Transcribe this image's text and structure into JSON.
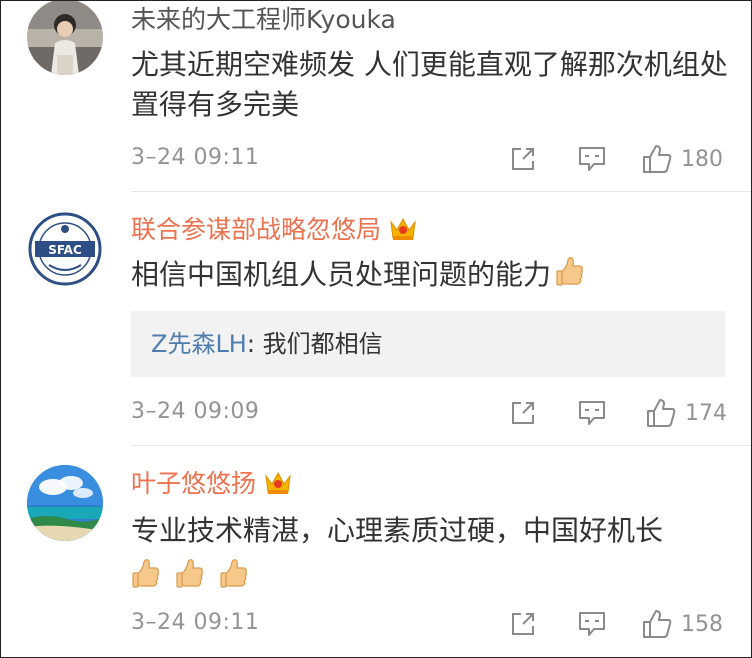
{
  "comments": [
    {
      "username": "未来的大工程师Kyouka",
      "vip": false,
      "text": "尤其近期空难频发 人们更能直观了解那次机组处置得有多完美",
      "time": "3–24 09:11",
      "likes": "180",
      "avatar_icon": "person-photo-avatar"
    },
    {
      "username": "联合参谋部战略忽悠局",
      "vip": true,
      "text": "相信中国机组人员处理问题的能力",
      "reply": {
        "user": "Z先森LH",
        "separator": ": ",
        "text": "我们都相信"
      },
      "time": "3–24 09:09",
      "likes": "174",
      "avatar_icon": "sfac-emblem-avatar",
      "avatar_text": "SFAC"
    },
    {
      "username": "叶子悠悠扬",
      "vip": true,
      "text": "专业技术精湛，心理素质过硬，中国好机长",
      "time": "3–24 09:11",
      "likes": "158",
      "avatar_icon": "beach-landscape-avatar"
    }
  ],
  "icons": {
    "share": "share-icon",
    "comment": "comment-icon",
    "like": "thumbs-up-icon",
    "vip": "crown-icon",
    "emoji": "thumbs-up-emoji"
  },
  "colors": {
    "vip_name": "#eb7350",
    "reply_user": "#507daf",
    "meta_gray": "#939393",
    "reply_bg": "#f2f2f2"
  }
}
